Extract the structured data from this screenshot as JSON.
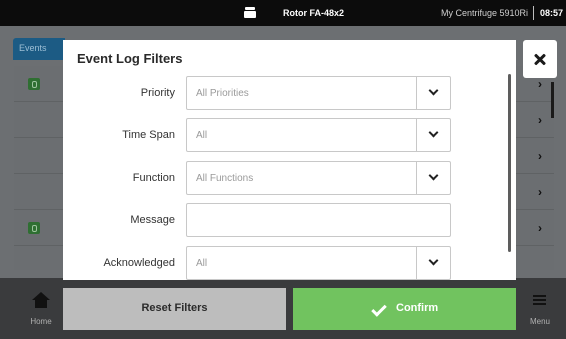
{
  "status_bar": {
    "rotor_icon": "rotor-icon",
    "rotor_name": "Rotor FA-48x2",
    "device_name": "My Centrifuge 5910Ri",
    "time": "08:57"
  },
  "background": {
    "tab_label": "Events",
    "row_count": 6,
    "home_icon": "home-icon",
    "home_label": "Home",
    "menu_icon": "menu-icon",
    "menu_label": "Menu"
  },
  "dialog": {
    "title": "Event Log Filters",
    "close_icon": "close-icon",
    "fields": [
      {
        "label": "Priority",
        "type": "select",
        "value": "All Priorities"
      },
      {
        "label": "Time Span",
        "type": "select",
        "value": "All"
      },
      {
        "label": "Function",
        "type": "select",
        "value": "All Functions"
      },
      {
        "label": "Message",
        "type": "text",
        "value": ""
      },
      {
        "label": "Acknowledged",
        "type": "select",
        "value": "All"
      }
    ]
  },
  "actions": {
    "reset_label": "Reset Filters",
    "confirm_label": "Confirm",
    "confirm_icon": "checkmark-icon"
  },
  "colors": {
    "accent_blue": "#1c5b84",
    "confirm_green": "#71c35f",
    "reset_gray": "#bdbdbd",
    "status_green": "#2f6f32"
  }
}
